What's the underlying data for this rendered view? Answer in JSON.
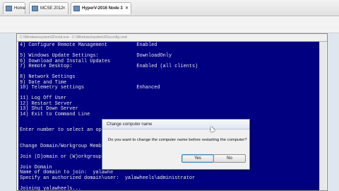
{
  "tabs": [
    {
      "label": "Home",
      "active": false
    },
    {
      "label": "MCSE 2012",
      "active": false
    },
    {
      "label": "HyperV-2016 Node 3",
      "active": true
    }
  ],
  "console": {
    "window_title": "C:\\Windows\\system32\\cmd.exe - C:\\Windows\\system32\\sconfig.cmd",
    "lines": [
      "4) Configure Remote Management          Enabled",
      "",
      "5) Windows Update Settings:             DownloadOnly",
      "6) Download and Install Updates",
      "7) Remote Desktop:                      Enabled (all clients)",
      "",
      "8) Network Settings",
      "9) Date and Time",
      "10) Telemetry settings                  Enhanced",
      "",
      "11) Log Off User",
      "12) Restart Server",
      "13) Shut Down Server",
      "14) Exit to Command Line",
      "",
      "",
      "Enter number to select an option",
      "",
      "",
      "Change Domain/Workgroup Membersh",
      "",
      "Join (D)omain or (W)orkgroup? (B",
      "",
      "Join Domain",
      "Name of domain to join:  yalawhe",
      "Specify an authorized domain\\user:  yalawheels\\administrator",
      "",
      "Joining yalawheels..."
    ]
  },
  "dialog": {
    "title": "Change computer name",
    "message": "Do you want to change the computer name before restarting the computer?",
    "yes_label": "Yes",
    "no_label": "No"
  }
}
